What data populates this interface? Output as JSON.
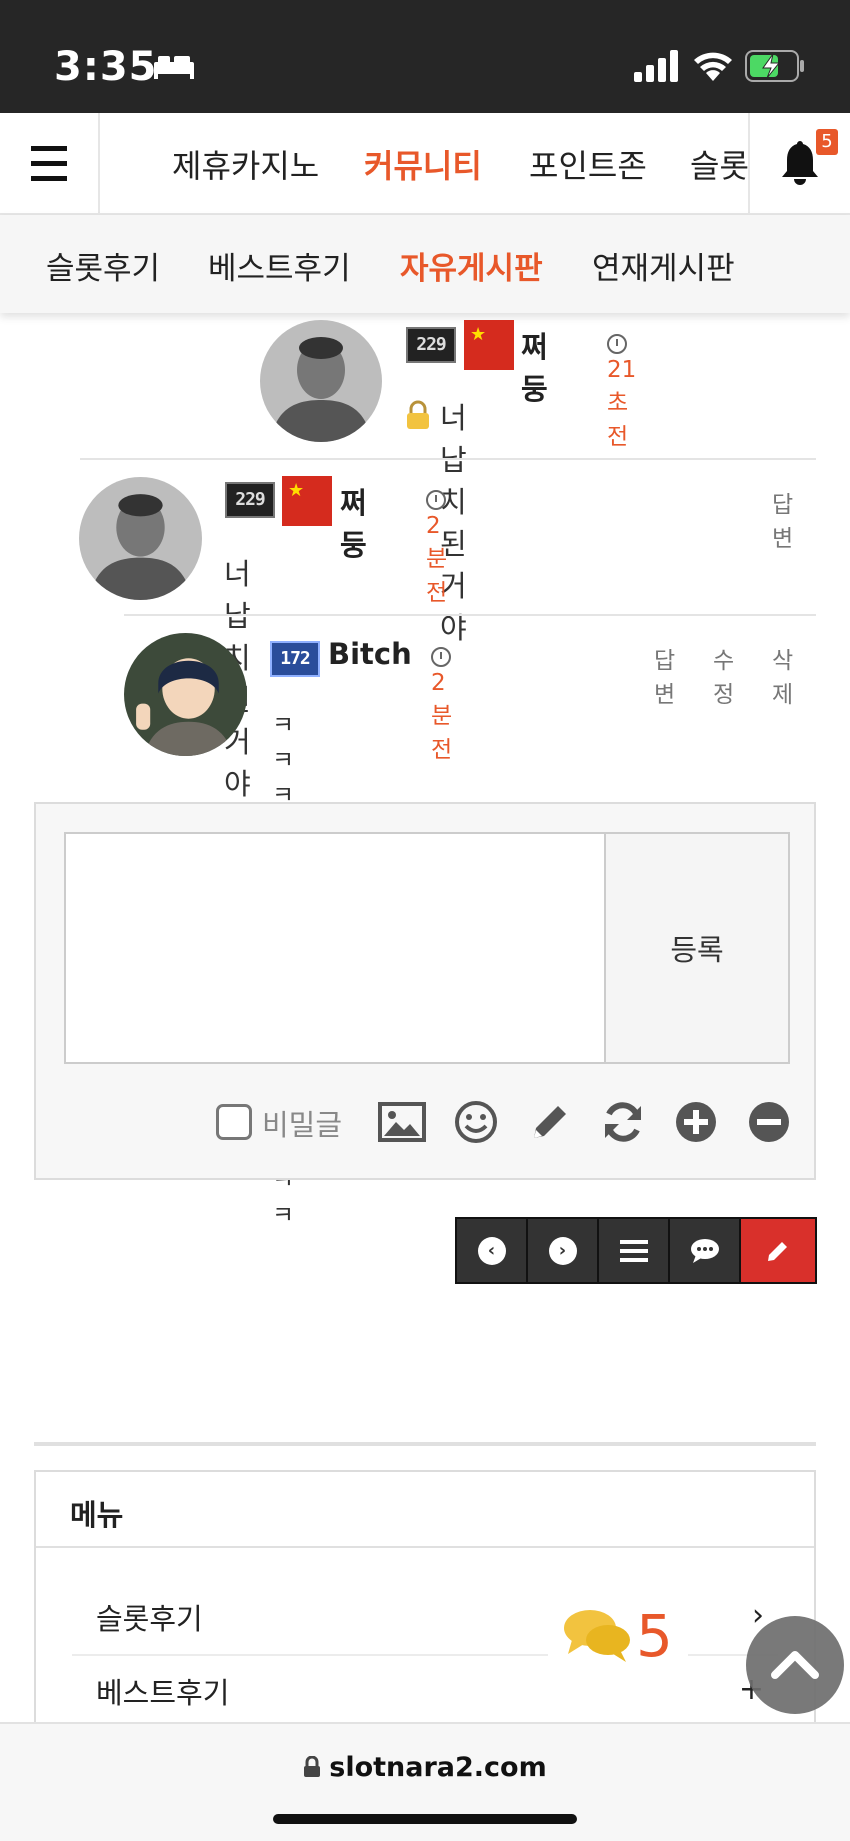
{
  "status_bar": {
    "time": "3:35"
  },
  "top_nav": {
    "items": [
      "제휴카지노",
      "커뮤니티",
      "포인트존",
      "슬롯"
    ],
    "active_index": 1,
    "notification_count": "5"
  },
  "sub_nav": {
    "items": [
      "슬롯후기",
      "베스트후기",
      "자유게시판",
      "연재게시판"
    ],
    "active_index": 2
  },
  "comments": [
    {
      "level": "229",
      "author": "쩌둥",
      "time": "21초전",
      "text": "너납치된거야",
      "locked": true,
      "actions": []
    },
    {
      "level": "229",
      "author": "쩌둥",
      "time": "2분전",
      "text": "너 납치된거야",
      "locked": false,
      "actions": [
        "답변"
      ]
    },
    {
      "level": "172",
      "author": "Bitch",
      "time": "2분전",
      "text": "ㅋㅋㅋㅋㅋㅋㅋㅋㅋㅋㅋㅋㅋㅋㅋ",
      "locked": false,
      "actions": [
        "답변",
        "수정",
        "삭제"
      ]
    }
  ],
  "comment_form": {
    "textarea_value": "",
    "submit_label": "등록",
    "secret_label": "비밀글"
  },
  "menu": {
    "title": "메뉴",
    "items": [
      "슬롯후기",
      "베스트후기"
    ]
  },
  "floating": {
    "comment_count": "5"
  },
  "browser": {
    "url": "slotnara2.com"
  },
  "colors": {
    "accent": "#e8582a",
    "write_button": "#d9302b",
    "status_bar": "#262626"
  }
}
